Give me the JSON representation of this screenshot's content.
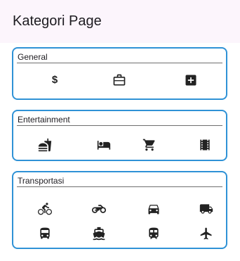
{
  "appbar": {
    "title": "Kategori Page"
  },
  "categories": [
    {
      "label": "General",
      "icons": [
        "dollar-icon",
        "briefcase-icon",
        "medical-plus-icon"
      ]
    },
    {
      "label": "Entertainment",
      "icons": [
        "fastfood-icon",
        "hotel-bed-icon",
        "shopping-cart-icon",
        "movie-film-icon"
      ]
    },
    {
      "label": "Transportasi",
      "icons": [
        "bicycle-icon",
        "motorcycle-icon",
        "car-icon",
        "truck-icon",
        "bus-icon",
        "ferry-icon",
        "train-icon",
        "airplane-icon"
      ]
    }
  ],
  "general": {
    "dollar_glyph": "$"
  },
  "colors": {
    "border": "#2f92d6",
    "appbar_bg": "#fcf5fc",
    "icon": "#222222"
  }
}
